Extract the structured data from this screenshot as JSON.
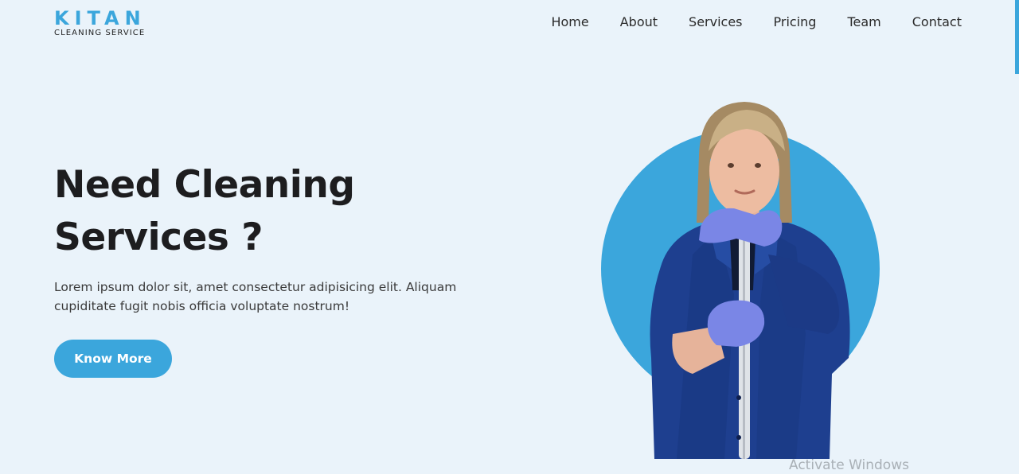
{
  "logo": {
    "main": "KITAN",
    "sub": "CLEANING SERVICE"
  },
  "nav": {
    "items": [
      "Home",
      "About",
      "Services",
      "Pricing",
      "Team",
      "Contact"
    ]
  },
  "hero": {
    "title_line1": "Need Cleaning",
    "title_line2": "Services ?",
    "text_line1": "Lorem ipsum dolor sit, amet consectetur adipisicing elit. Aliquam",
    "text_line2": "cupiditate fugit nobis officia voluptate nostrum!",
    "cta_label": "Know More"
  },
  "image": {
    "subject": "cleaner-with-mop"
  },
  "os_watermark": {
    "text": "Activate Windows"
  },
  "colors": {
    "accent": "#3ba6dc",
    "background": "#eaf3fa",
    "heading": "#1d1d1f",
    "uniform": "#1e3f8f",
    "gloves": "#7a86e6"
  }
}
